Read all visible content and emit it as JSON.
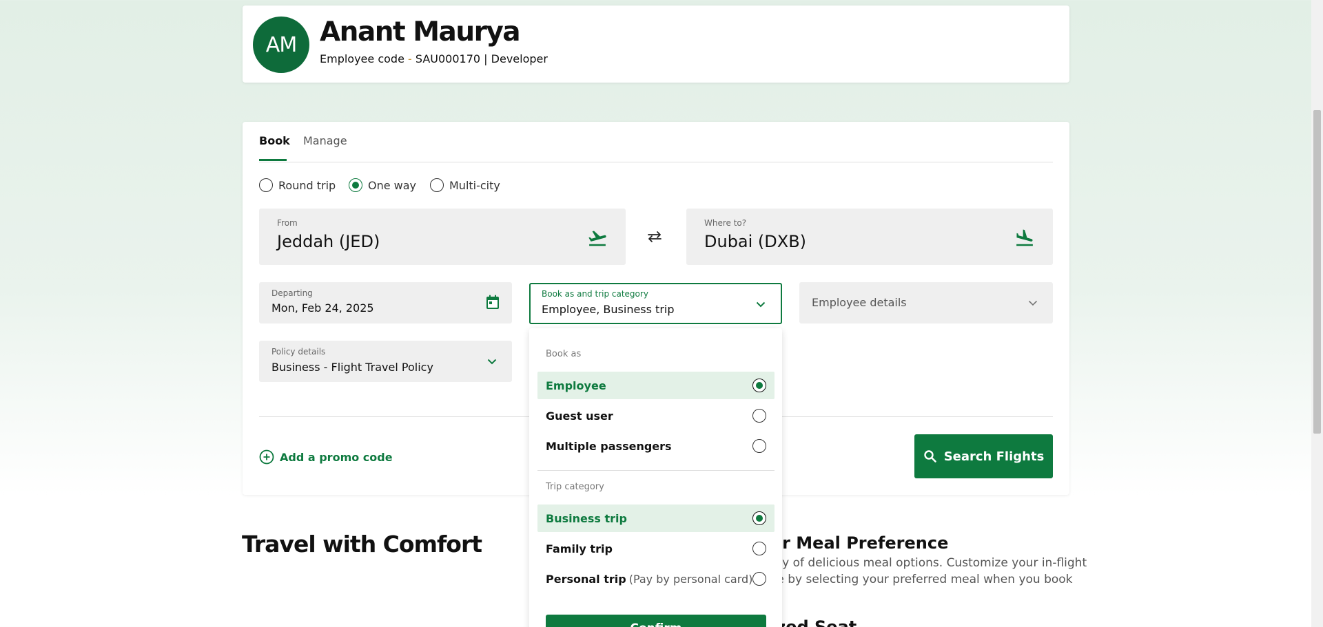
{
  "profile": {
    "initials": "AM",
    "name": "Anant Maurya",
    "code_label": "Employee code",
    "code_dash": "-",
    "code": "SAU000170",
    "separator": "|",
    "role": "Developer"
  },
  "tabs": [
    {
      "label": "Book",
      "active": true
    },
    {
      "label": "Manage",
      "active": false
    }
  ],
  "trip_types": [
    {
      "label": "Round trip",
      "checked": false
    },
    {
      "label": "One way",
      "checked": true
    },
    {
      "label": "Multi-city",
      "checked": false
    }
  ],
  "from": {
    "label": "From",
    "value": "Jeddah (JED)"
  },
  "to": {
    "label": "Where to?",
    "value": "Dubai (DXB)"
  },
  "departing": {
    "label": "Departing",
    "value": "Mon, Feb 24, 2025"
  },
  "book_as": {
    "label": "Book as and trip category",
    "value": "Employee, Business trip"
  },
  "employee_details": {
    "placeholder": "Employee details"
  },
  "policy": {
    "label": "Policy details",
    "value": "Business - Flight Travel Policy"
  },
  "promo": {
    "label": "Add a promo code"
  },
  "search": {
    "label": "Search Flights"
  },
  "dropdown": {
    "book_as_title": "Book as",
    "book_as_options": [
      {
        "label": "Employee",
        "selected": true
      },
      {
        "label": "Guest user",
        "selected": false
      },
      {
        "label": "Multiple passengers",
        "selected": false
      }
    ],
    "trip_category_title": "Trip category",
    "trip_category_options": [
      {
        "label": "Business trip",
        "note": "",
        "selected": true
      },
      {
        "label": "Family trip",
        "note": "",
        "selected": false
      },
      {
        "label": "Personal trip",
        "note": "(Pay by personal card)",
        "selected": false
      }
    ],
    "confirm_label": "Confirm"
  },
  "content": {
    "comfort_heading": "Travel with Comfort",
    "meal_heading": "ur Meal Preference",
    "meal_line1": "ety of delicious meal options. Customize your in-flight",
    "meal_line2": "ce by selecting your preferred meal when you book",
    "next_heading": "ized Seat"
  },
  "colors": {
    "brand_green": "#0e7a3f",
    "avatar_green": "#0e6b3a",
    "selected_bg": "#e3f1e7"
  }
}
